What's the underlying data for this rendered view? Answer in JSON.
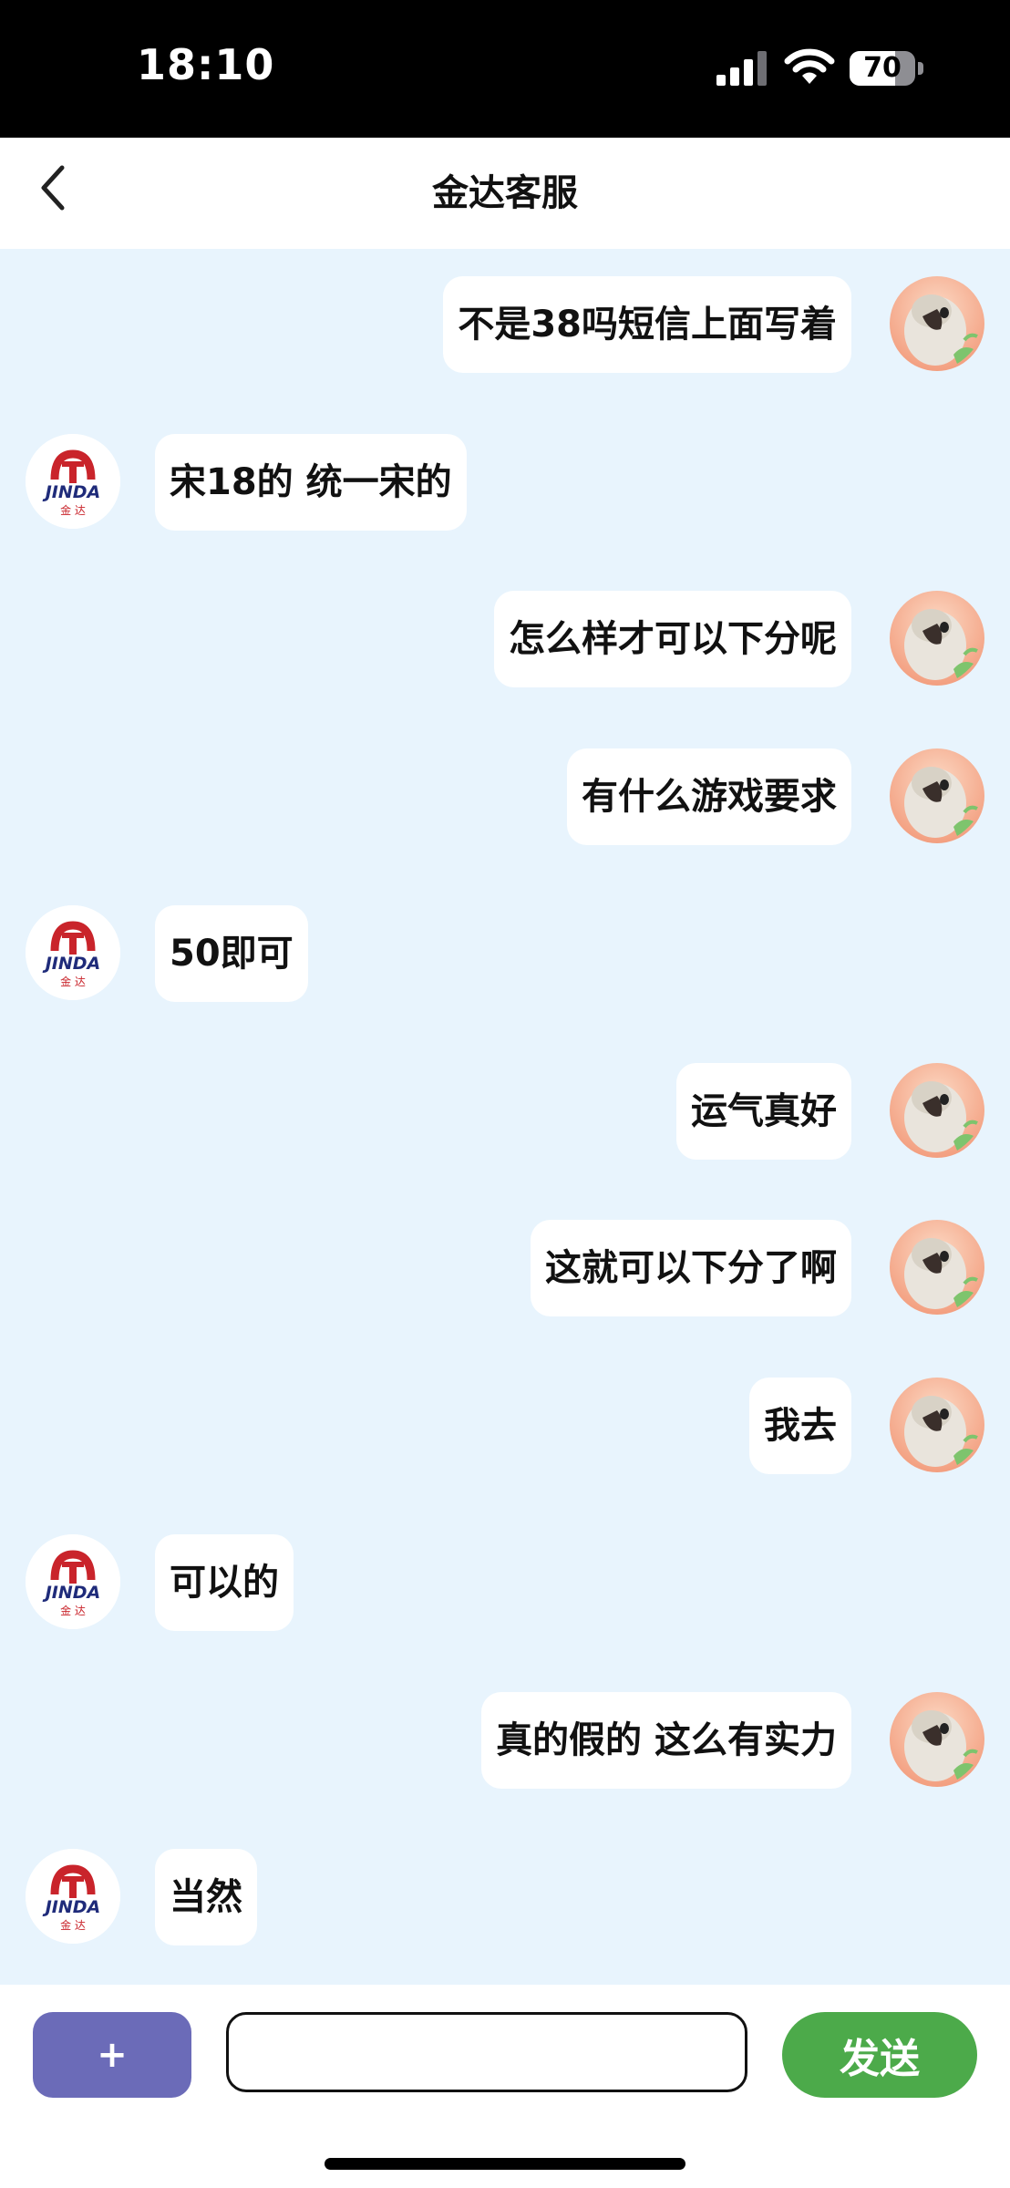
{
  "status_bar": {
    "time": "18:10",
    "battery": "70",
    "battery_level": 0.7
  },
  "nav": {
    "title": "金达客服",
    "back_icon": "chevron-left-icon"
  },
  "brand": {
    "logo_text": "JINDA",
    "logo_sub": "金 达",
    "red": "#c9242b",
    "navy": "#1f2b7a"
  },
  "messages": [
    {
      "from": "user",
      "text": "不是38吗短信上面写着"
    },
    {
      "from": "cs",
      "text": "宋18的 统一宋的"
    },
    {
      "from": "user",
      "text": "怎么样才可以下分呢"
    },
    {
      "from": "user",
      "text": "有什么游戏要求"
    },
    {
      "from": "cs",
      "text": "50即可"
    },
    {
      "from": "user",
      "text": "运气真好"
    },
    {
      "from": "user",
      "text": "这就可以下分了啊"
    },
    {
      "from": "user",
      "text": "我去"
    },
    {
      "from": "cs",
      "text": "可以的"
    },
    {
      "from": "user",
      "text": "真的假的 这么有实力"
    },
    {
      "from": "cs",
      "text": "当然"
    }
  ],
  "input_bar": {
    "plus_label": "+",
    "input_value": "",
    "send_label": "发送"
  },
  "colors": {
    "chat_bg": "#e8f4fd",
    "plus_bg": "#6b6bb8",
    "send_bg": "#4caa4a"
  }
}
